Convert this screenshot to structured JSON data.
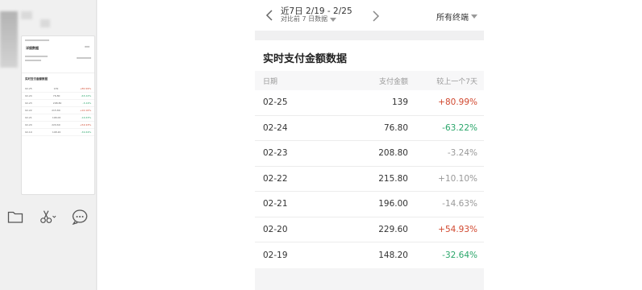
{
  "header": {
    "range": "近7日 2/19 - 2/25",
    "compare": "对比前 7 日数据",
    "terminal": "所有终端"
  },
  "card": {
    "title": "实时支付金额数据",
    "columns": [
      "日期",
      "支付金额",
      "较上一个7天"
    ]
  },
  "rows": [
    {
      "date": "02-25",
      "amount": "139",
      "change": "+80.99%",
      "trend": "pos"
    },
    {
      "date": "02-24",
      "amount": "76.80",
      "change": "-63.22%",
      "trend": "neg"
    },
    {
      "date": "02-23",
      "amount": "208.80",
      "change": "-3.24%",
      "trend": "neutral"
    },
    {
      "date": "02-22",
      "amount": "215.80",
      "change": "+10.10%",
      "trend": "neutral"
    },
    {
      "date": "02-21",
      "amount": "196.00",
      "change": "-14.63%",
      "trend": "neutral"
    },
    {
      "date": "02-20",
      "amount": "229.60",
      "change": "+54.93%",
      "trend": "pos"
    },
    {
      "date": "02-19",
      "amount": "148.20",
      "change": "-32.64%",
      "trend": "neg"
    }
  ],
  "thumbnail": {
    "title": "详细数据",
    "section": "实时支付金额数据",
    "rows": [
      {
        "date": "02-25",
        "amount": "139",
        "change": "+80.99%"
      },
      {
        "date": "02-24",
        "amount": "76.80",
        "change": "-63.22%"
      },
      {
        "date": "02-23",
        "amount": "208.80",
        "change": "-3.24%"
      },
      {
        "date": "02-22",
        "amount": "215.80",
        "change": "+10.10%"
      },
      {
        "date": "02-21",
        "amount": "196.00",
        "change": "-14.63%"
      },
      {
        "date": "02-20",
        "amount": "229.60",
        "change": "+54.93%"
      },
      {
        "date": "02-19",
        "amount": "148.20",
        "change": "-32.64%"
      }
    ]
  },
  "colors": {
    "positive": "#d1482f",
    "negative": "#2aa66a",
    "neutral": "#999999"
  },
  "icons": [
    "folder-icon",
    "scissors-icon",
    "chat-bubble-icon",
    "chevron-left-icon",
    "chevron-right-icon",
    "caret-down-icon"
  ]
}
